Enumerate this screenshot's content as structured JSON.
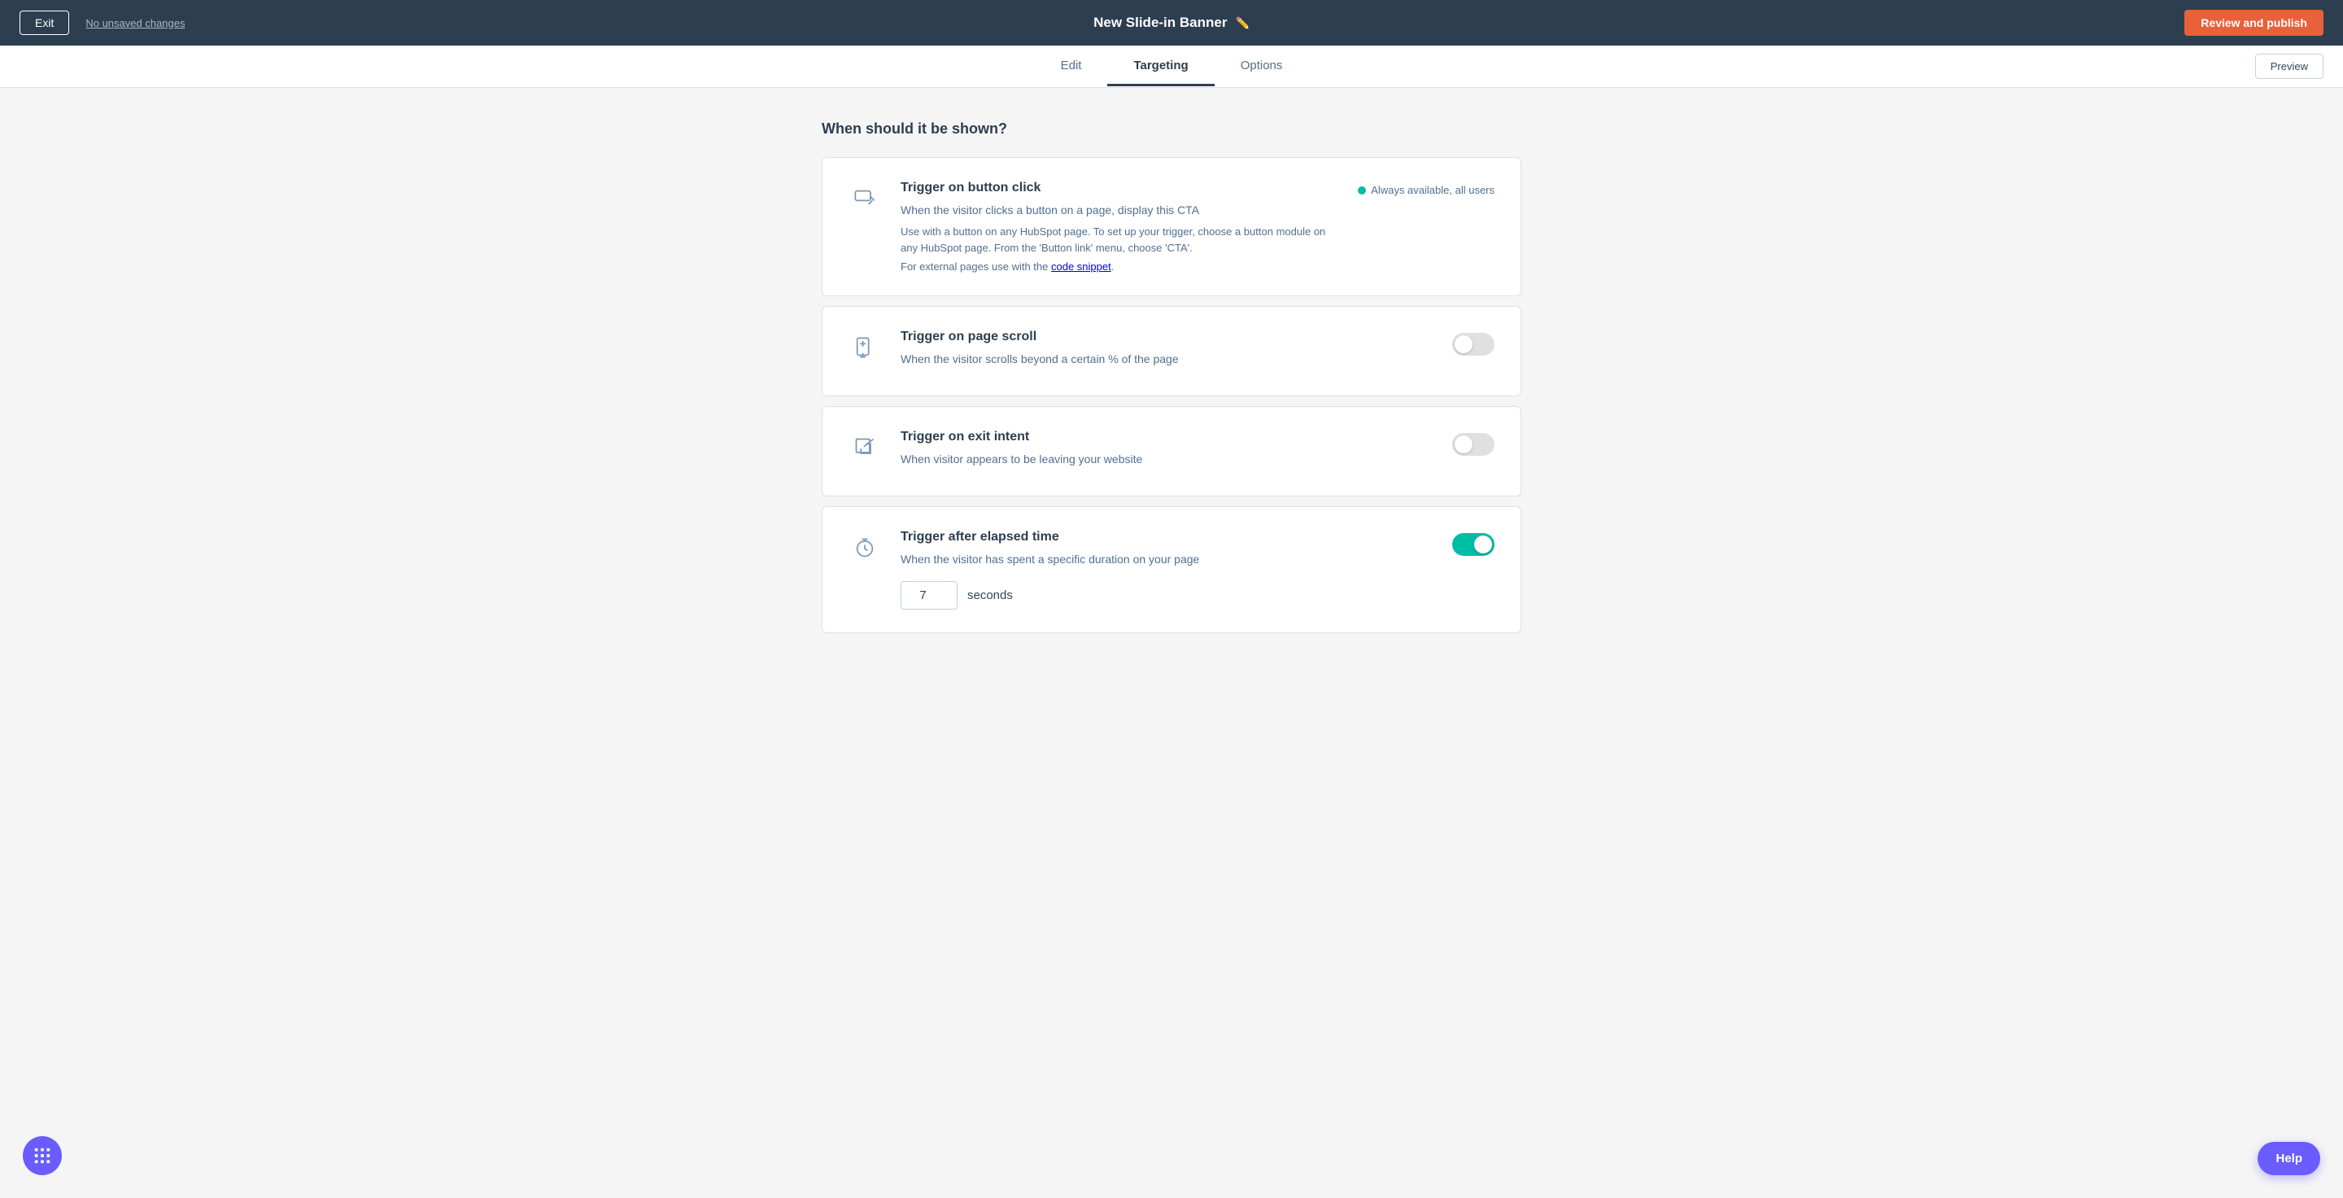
{
  "topNav": {
    "exitLabel": "Exit",
    "unsavedLabel": "No unsaved changes",
    "pageTitle": "New Slide-in Banner",
    "reviewLabel": "Review and publish"
  },
  "tabs": [
    {
      "id": "edit",
      "label": "Edit",
      "active": false
    },
    {
      "id": "targeting",
      "label": "Targeting",
      "active": true
    },
    {
      "id": "options",
      "label": "Options",
      "active": false
    }
  ],
  "previewLabel": "Preview",
  "sectionTitle": "When should it be shown?",
  "triggers": [
    {
      "id": "button-click",
      "iconType": "cursor",
      "title": "Trigger on button click",
      "description": "When the visitor clicks a button on a page, display this CTA",
      "subtext": "Use with a button on any HubSpot page. To set up your trigger, choose a button module on any HubSpot page. From the 'Button link' menu, choose 'CTA'.",
      "externalText": "For external pages use with the ",
      "externalLinkText": "code snippet",
      "status": "always",
      "statusLabel": "Always available, all users",
      "toggleState": "none"
    },
    {
      "id": "page-scroll",
      "iconType": "scroll",
      "title": "Trigger on page scroll",
      "description": "When the visitor scrolls beyond a certain % of the page",
      "subtext": "",
      "externalText": "",
      "externalLinkText": "",
      "status": "toggle",
      "statusLabel": "",
      "toggleState": "off"
    },
    {
      "id": "exit-intent",
      "iconType": "exit",
      "title": "Trigger on exit intent",
      "description": "When visitor appears to be leaving your website",
      "subtext": "",
      "externalText": "",
      "externalLinkText": "",
      "status": "toggle",
      "statusLabel": "",
      "toggleState": "off"
    },
    {
      "id": "elapsed-time",
      "iconType": "clock",
      "title": "Trigger after elapsed time",
      "description": "When the visitor has spent a specific duration on your page",
      "subtext": "",
      "externalText": "",
      "externalLinkText": "",
      "status": "toggle",
      "statusLabel": "",
      "toggleState": "on",
      "durationValue": "7",
      "durationUnit": "seconds"
    }
  ],
  "helpLabel": "Help",
  "colors": {
    "accent": "#e8613a",
    "teal": "#00bda5",
    "navBg": "#2d3e50",
    "purple": "#6b5cff"
  }
}
